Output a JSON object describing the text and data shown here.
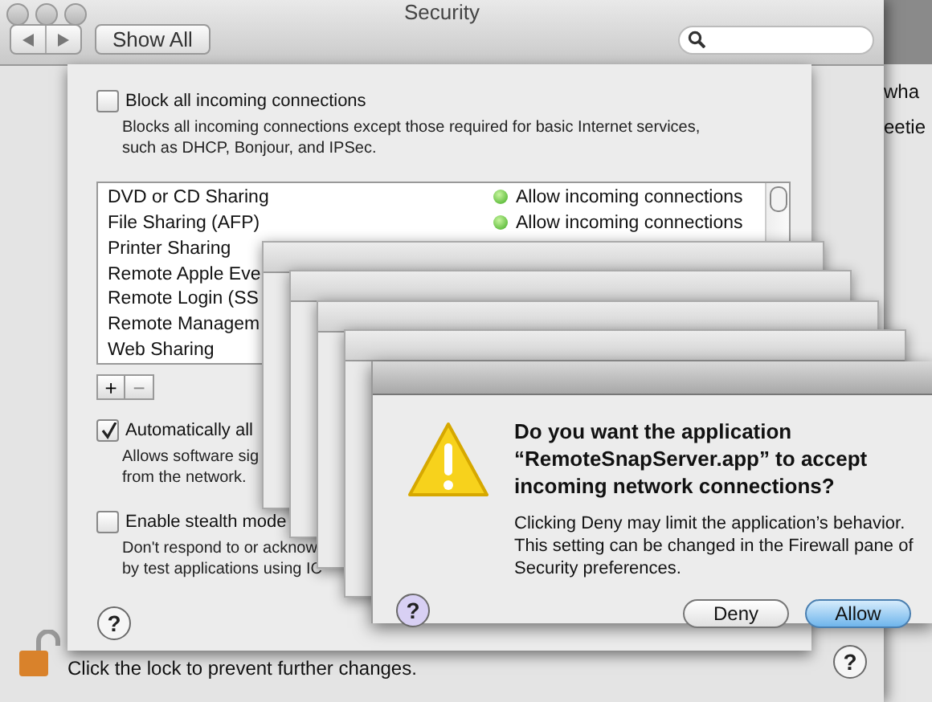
{
  "window": {
    "title": "Security",
    "show_all": "Show All"
  },
  "background_window": {
    "texts": [
      "wha",
      "eetie"
    ]
  },
  "sheet": {
    "options": [
      {
        "label": "Block all incoming connections",
        "checked": false,
        "description": [
          "Blocks all incoming connections except those required for basic Internet services,",
          "such as DHCP, Bonjour, and IPSec."
        ]
      }
    ],
    "services": [
      {
        "name": "DVD or CD Sharing",
        "status": "Allow incoming connections"
      },
      {
        "name": "File Sharing (AFP)",
        "status": "Allow incoming connections"
      },
      {
        "name": "Printer Sharing"
      },
      {
        "name": "Remote Apple Eve"
      },
      {
        "name": "Remote Login (SS"
      },
      {
        "name": "Remote Managem"
      },
      {
        "name": "Web Sharing"
      }
    ],
    "add": "+",
    "remove": "−",
    "help": "?",
    "more_options": [
      {
        "label": "Automatically all",
        "checked": true,
        "description": [
          "Allows software sig",
          "from the network."
        ]
      },
      {
        "label": "Enable stealth mode",
        "checked": false,
        "description": [
          "Don't respond to or acknow",
          "by test applications using IC"
        ]
      }
    ]
  },
  "lock_text": "Click the lock to prevent further changes.",
  "window_help": "?",
  "dialog": {
    "title": "Do you want the application “RemoteSnapServer.app” to accept incoming network connections?",
    "message": "Clicking Deny may limit the application’s behavior. This setting can be changed in the Firewall pane of Security preferences.",
    "help": "?",
    "buttons": [
      {
        "label": "Deny",
        "default": false
      },
      {
        "label": "Allow",
        "default": true
      }
    ]
  }
}
